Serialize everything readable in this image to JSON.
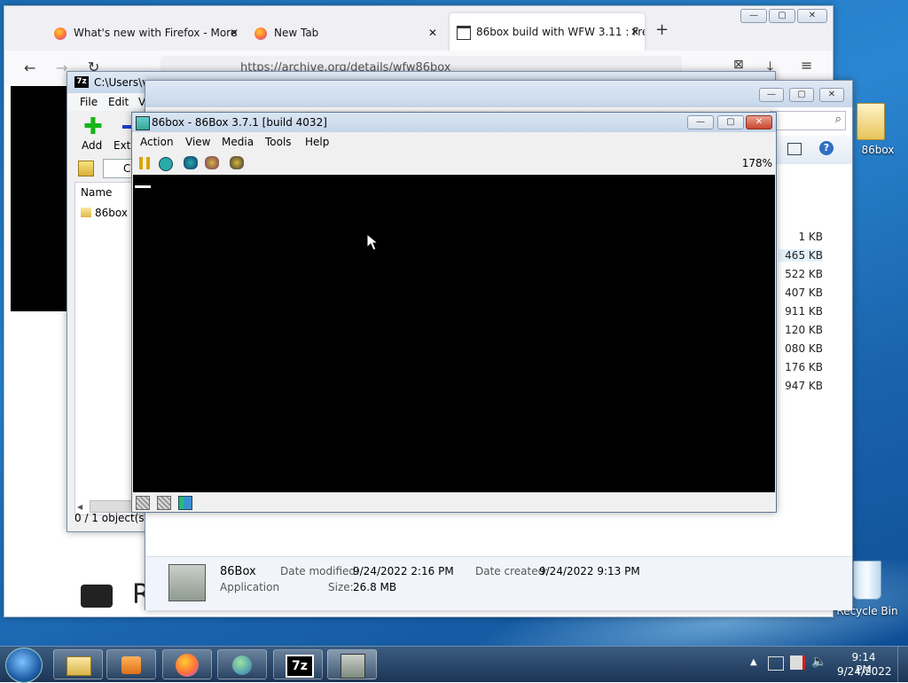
{
  "firefox": {
    "tabs": [
      {
        "label": "What's new with Firefox - More"
      },
      {
        "label": "New Tab"
      },
      {
        "label": "86box build with WFW 3.11 : Fre"
      }
    ],
    "url": "https://archive.org/details/wfw86box",
    "content_partial_text": "R"
  },
  "sevenzip": {
    "title": "C:\\Users\\v",
    "menu": [
      "File",
      "Edit",
      "V"
    ],
    "toolbar": {
      "add_label": "Add",
      "extract_label": "Extr"
    },
    "column_name": "Name",
    "path_partial": "C",
    "items": [
      {
        "name": "86box"
      }
    ],
    "status": "0 / 1 object(s) s"
  },
  "explorer": {
    "sizes": [
      "1 KB",
      "465 KB",
      "522 KB",
      "407 KB",
      "911 KB",
      "120 KB",
      "080 KB",
      "176 KB",
      "947 KB"
    ],
    "details": {
      "name": "86Box",
      "type": "Application",
      "date_modified_label": "Date modified:",
      "date_modified": "9/24/2022 2:16 PM",
      "date_created_label": "Date created:",
      "date_created": "9/24/2022 9:13 PM",
      "size_label": "Size:",
      "size": "26.8 MB"
    }
  },
  "box86": {
    "title": "86box - 86Box 3.7.1 [build 4032]",
    "menu": [
      "Action",
      "View",
      "Media",
      "Tools",
      "Help"
    ],
    "zoom": "178%"
  },
  "desktop": {
    "folder_label": "86box",
    "recycle_bin_label": "Recycle Bin"
  },
  "taskbar": {
    "time": "9:14 PM",
    "date": "9/24/2022",
    "sevenzip_label": "7z"
  }
}
